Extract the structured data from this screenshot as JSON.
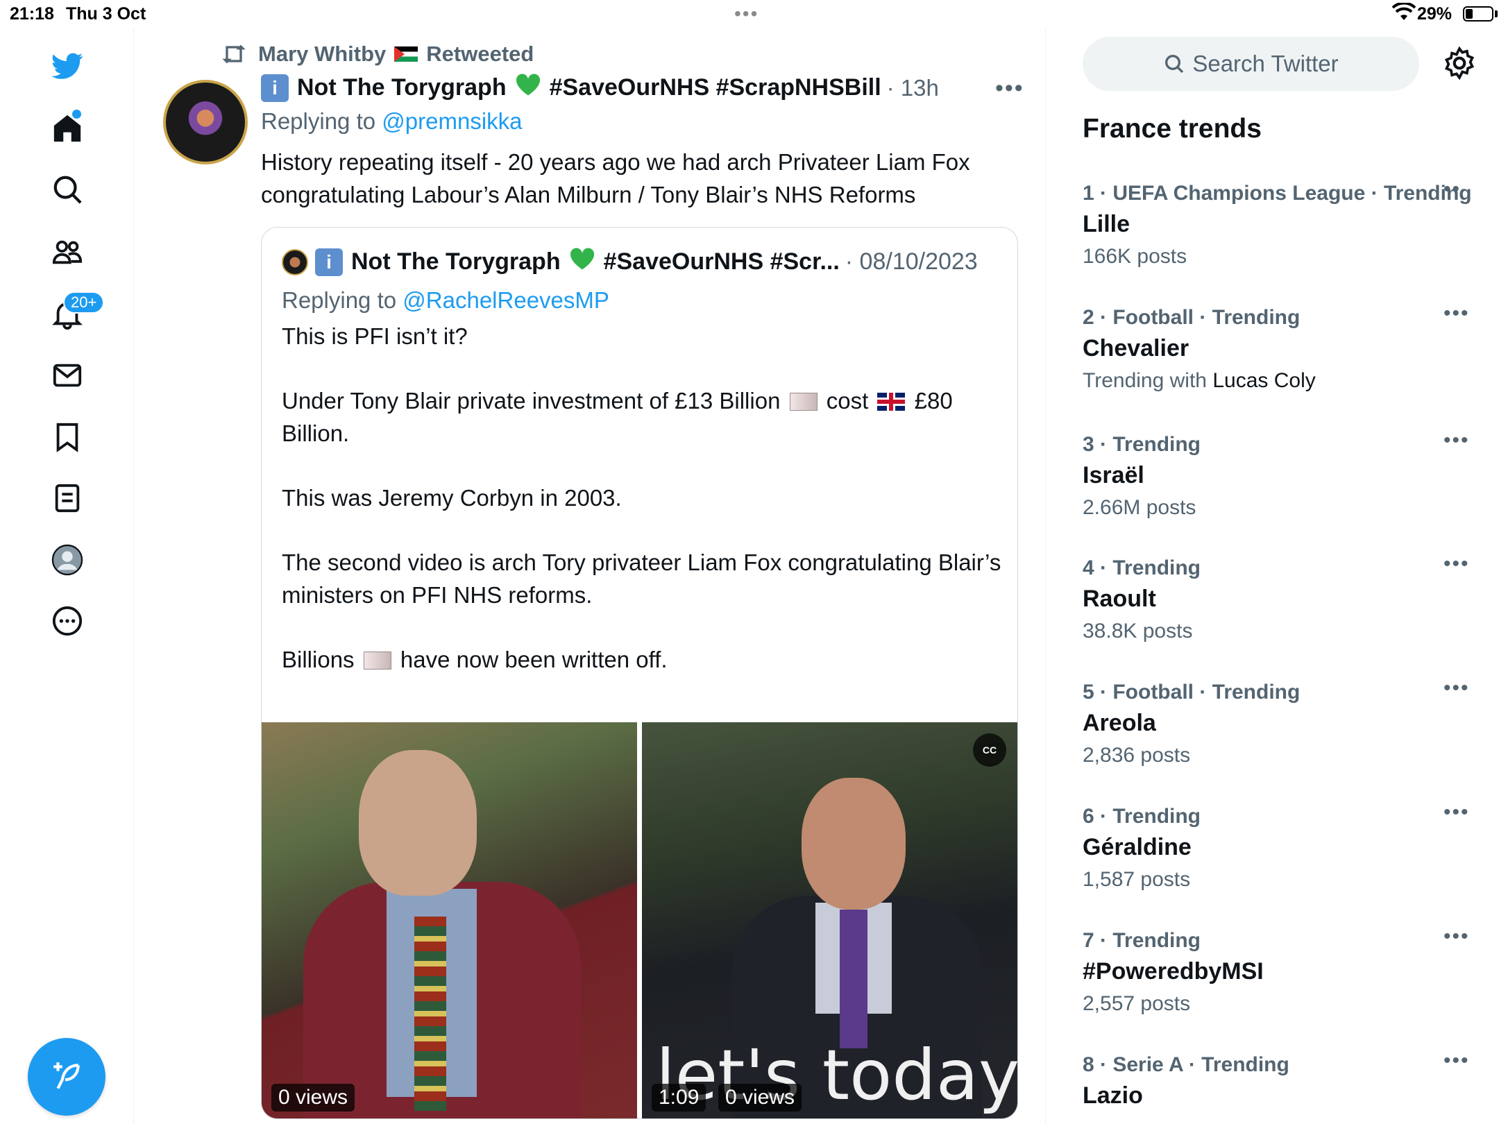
{
  "status_bar": {
    "time": "21:18",
    "date": "Thu 3 Oct",
    "battery": "29%"
  },
  "nav": {
    "notifications_badge": "20+"
  },
  "tweet": {
    "retweeted_by": "Mary Whitby",
    "retweeted_label": "Retweeted",
    "author": "Not The Torygraph",
    "hashtags": "#SaveOurNHS #ScrapNHSBill",
    "time": "· 13h",
    "replying_prefix": "Replying to",
    "replying_handle": "@premnsikka",
    "text": "History repeating itself - 20 years ago we had arch Privateer Liam Fox congratulating Labour’s Alan Milburn / Tony Blair’s NHS Reforms"
  },
  "quote": {
    "author": "Not The Torygraph",
    "hashtags": "#SaveOurNHS #Scr...",
    "date": "· 08/10/2023",
    "replying_prefix": "Replying to",
    "replying_handle": "@RachelReevesMP",
    "p1": "This is PFI isn’t it?",
    "p2a": "Under Tony Blair private investment of £13 Billion",
    "p2b": "cost",
    "p2c": "£80 Billion.",
    "p3": "This was Jeremy Corbyn in 2003.",
    "p4": "The second video is arch Tory privateer Liam Fox congratulating Blair’s ministers on PFI NHS reforms.",
    "p5a": "Billions",
    "p5b": "have now been written off.",
    "video1_views": "0 views",
    "video2_duration": "1:09",
    "video2_views": "0 views",
    "video2_caption": "let's today ta"
  },
  "sidebar": {
    "search_placeholder": "Search Twitter",
    "trends_title": "France trends",
    "trends": [
      {
        "category": "1 · UEFA Champions League · Trending",
        "name": "Lille",
        "count": "166K posts"
      },
      {
        "category": "2 · Football · Trending",
        "name": "Chevalier",
        "count_prefix": "Trending with",
        "count_bold": "Lucas Coly"
      },
      {
        "category": "3 · Trending",
        "name": "Israël",
        "count": "2.66M posts"
      },
      {
        "category": "4 · Trending",
        "name": "Raoult",
        "count": "38.8K posts"
      },
      {
        "category": "5 · Football · Trending",
        "name": "Areola",
        "count": "2,836 posts"
      },
      {
        "category": "6 · Trending",
        "name": "Géraldine",
        "count": "1,587 posts"
      },
      {
        "category": "7 · Trending",
        "name": "#PoweredbyMSI",
        "count": "2,557 posts"
      },
      {
        "category": "8 · Serie A · Trending",
        "name": "Lazio",
        "count": ""
      }
    ]
  }
}
